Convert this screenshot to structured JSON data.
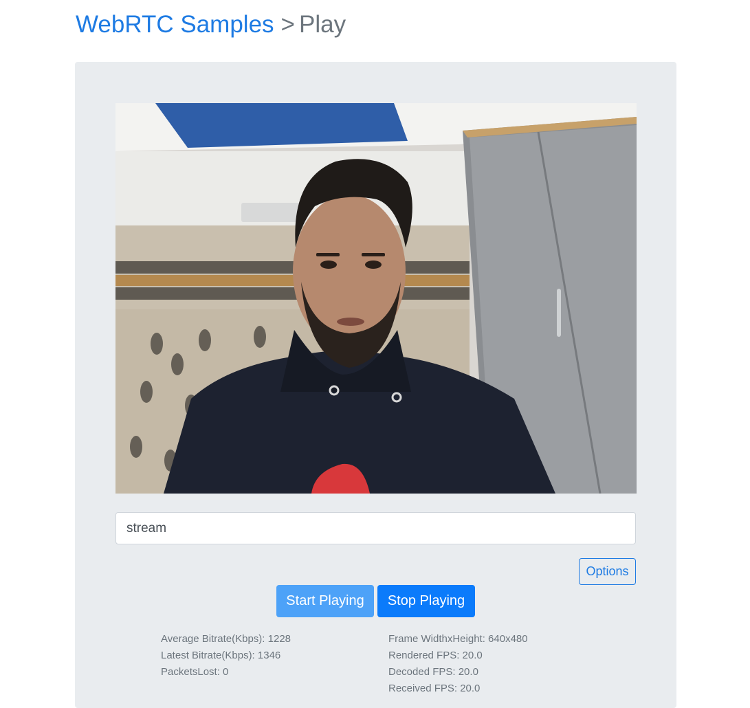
{
  "header": {
    "site_link": "WebRTC Samples",
    "separator": ">",
    "page": "Play"
  },
  "player": {
    "video_description": "Webcam video stream of a person in a black hoodie"
  },
  "stream_input": {
    "value": "stream"
  },
  "buttons": {
    "options": "Options",
    "start": "Start Playing",
    "stop": "Stop Playing"
  },
  "stats": {
    "left": [
      "Average Bitrate(Kbps): 1228",
      "Latest Bitrate(Kbps): 1346",
      "PacketsLost: 0"
    ],
    "right": [
      "Frame WidthxHeight: 640x480",
      "Rendered FPS: 20.0",
      "Decoded FPS: 20.0",
      "Received FPS: 20.0"
    ]
  },
  "colors": {
    "link": "#1e7be3",
    "panel_bg": "#e9ecef",
    "start_button": "#4da2f8",
    "stop_button": "#0b7bfb",
    "muted_text": "#6c757d"
  }
}
